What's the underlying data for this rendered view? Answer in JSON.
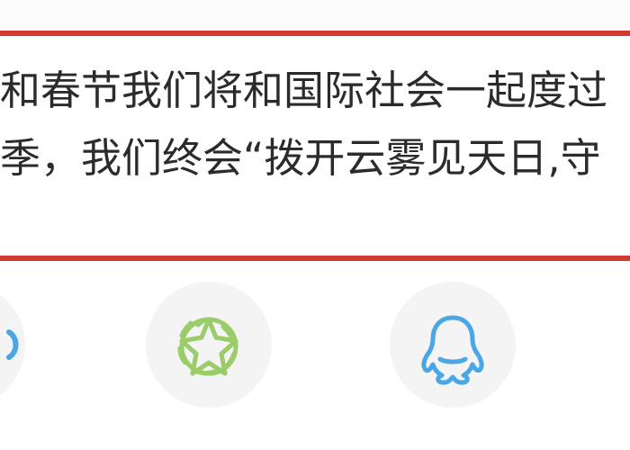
{
  "colors": {
    "accent_red": "#d23a2f",
    "text": "#2b2b2b",
    "circle_bg": "#f4f4f4",
    "moments_green": "#9acd6a",
    "qq_blue": "#4aa7e6",
    "left_icon_blue": "#4aa7e6"
  },
  "article": {
    "line1": "和春节我们将和国际社会一起度过",
    "line2": "季，我们终会“拨开云雾见天日,守"
  },
  "share": {
    "items": [
      {
        "icon": "partial-share-icon"
      },
      {
        "icon": "moments-icon"
      },
      {
        "icon": "qq-icon"
      }
    ]
  }
}
